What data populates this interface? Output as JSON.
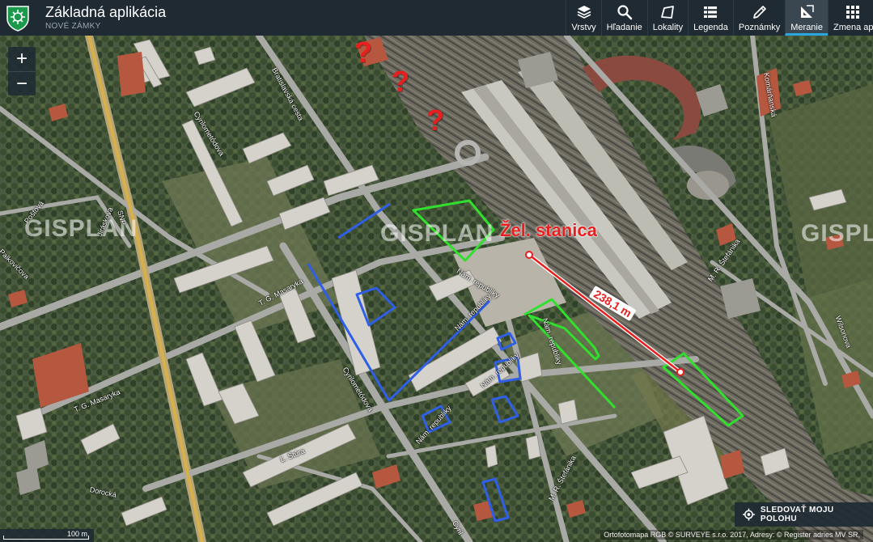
{
  "app": {
    "title": "Základná aplikácia",
    "subtitle": "NOVÉ ZÁMKY"
  },
  "toolbar": [
    {
      "label": "Vrstvy",
      "icon": "layers-icon"
    },
    {
      "label": "Hľadanie",
      "icon": "search-icon"
    },
    {
      "label": "Lokality",
      "icon": "map-icon"
    },
    {
      "label": "Legenda",
      "icon": "list-icon"
    },
    {
      "label": "Poznámky",
      "icon": "pencil-icon"
    },
    {
      "label": "Meranie",
      "icon": "ruler-icon",
      "active": true
    },
    {
      "label": "Zmena ap",
      "icon": "grid-icon"
    }
  ],
  "zoom": {
    "in": "+",
    "out": "−"
  },
  "annotations": {
    "station_label": "Žel. stanica",
    "distance_label": "238,1 m",
    "question_marks": [
      "?",
      "?",
      "?"
    ]
  },
  "watermarks": [
    "GISPLAN",
    "GISPLAN",
    "GISPLAN"
  ],
  "street_labels": [
    "Bratislavská cesta",
    "Cyrilometódova",
    "T. G. Masaryka",
    "SNP",
    "Jiráskova",
    "Poštová",
    "Palkovičova",
    "Nám. republiky",
    "Nám. republiky",
    "Nám. republiky",
    "Nám. republiky",
    "Cyrilometódova",
    "Nám. republiky",
    "Ľ. Štúra",
    "M. R. Štefánika",
    "M. R. Štefánika",
    "Dorocká",
    "T. G. Masaryka",
    "Komárňanská",
    "Wilsonova",
    "Cyril"
  ],
  "follow_button": {
    "label": "SLEDOVAŤ MOJU POLOHU",
    "icon": "crosshair-icon"
  },
  "scale": {
    "label": "100 m"
  },
  "attribution": "Ortofotomapa RGB © SURVEYE s.r.o. 2017, Adresy: © Register adries MV SR,",
  "colors": {
    "topbar": "#1f2a33",
    "accent": "#29a7de",
    "measure_line": "#e81f1f",
    "green_polygons": "#31e02d",
    "blue_polygons": "#2f5fe6"
  }
}
